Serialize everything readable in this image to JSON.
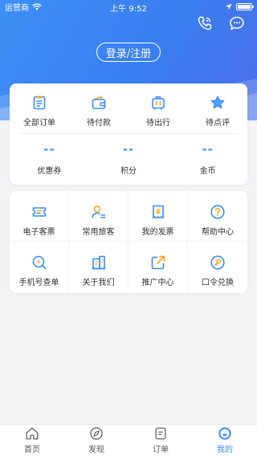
{
  "status_bar": {
    "carrier": "运营商",
    "time": "上午 9:52"
  },
  "header": {
    "login_label": "登录/注册"
  },
  "orders": [
    {
      "label": "全部订单",
      "icon": "all-orders-icon"
    },
    {
      "label": "待付款",
      "icon": "wallet-icon"
    },
    {
      "label": "待出行",
      "icon": "luggage-icon"
    },
    {
      "label": "待点评",
      "icon": "star-icon"
    }
  ],
  "assets": [
    {
      "label": "优惠券",
      "value": "--"
    },
    {
      "label": "积分",
      "value": "--"
    },
    {
      "label": "金币",
      "value": "--"
    }
  ],
  "services": [
    {
      "label": "电子客票",
      "icon": "ticket-icon"
    },
    {
      "label": "常用旅客",
      "icon": "passenger-icon"
    },
    {
      "label": "我的发票",
      "icon": "invoice-icon"
    },
    {
      "label": "帮助中心",
      "icon": "help-icon"
    },
    {
      "label": "手机号查单",
      "icon": "phone-search-icon"
    },
    {
      "label": "关于我们",
      "icon": "building-icon"
    },
    {
      "label": "推广中心",
      "icon": "share-icon"
    },
    {
      "label": "口令兑换",
      "icon": "key-icon"
    }
  ],
  "tabs": [
    {
      "label": "首页",
      "icon": "home-icon"
    },
    {
      "label": "发现",
      "icon": "discover-icon"
    },
    {
      "label": "订单",
      "icon": "order-icon"
    },
    {
      "label": "我的",
      "icon": "profile-icon",
      "active": true
    }
  ],
  "colors": {
    "accent": "#3a8df2",
    "header_start": "#3d8ff5",
    "header_end": "#4d6fe9",
    "icon_orange": "#f5a623"
  }
}
